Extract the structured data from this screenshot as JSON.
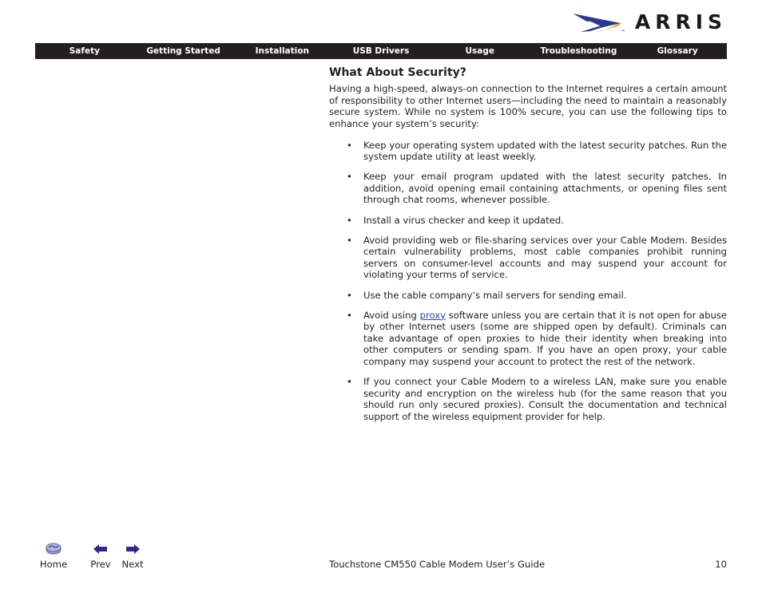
{
  "brand": {
    "name": "ARRIS",
    "logo_icon": "arris-swoosh-logo",
    "swoosh_blue": "#2b3990",
    "swoosh_orange": "#f7941e",
    "wordmark_color": "#1a1a1a"
  },
  "nav": {
    "background": "#231f20",
    "text_color": "#ffffff",
    "items": [
      {
        "label": "Safety"
      },
      {
        "label": "Getting Started"
      },
      {
        "label": "Installation"
      },
      {
        "label": "USB Drivers"
      },
      {
        "label": "Usage"
      },
      {
        "label": "Troubleshooting"
      },
      {
        "label": "Glossary"
      }
    ]
  },
  "main": {
    "title": "What About Security?",
    "intro": "Having a high-speed, always-on connection to the Internet requires a certain amount of responsibility to other Internet users—including the need to maintain a reasonably secure system. While no system is 100% secure, you can use the following tips to enhance your system’s security:",
    "bullet_glyph": "•",
    "tips": [
      {
        "text": "Keep your operating system updated with the latest security patches. Run the system update utility at least weekly."
      },
      {
        "text": "Keep your email program updated with the latest security patches. In addition, avoid opening email containing attachments, or opening files sent through chat rooms, whenever possible."
      },
      {
        "text": "Install a virus checker and keep it updated."
      },
      {
        "text": "Avoid providing web or file-sharing services over your Cable Modem. Besides certain vulnerability problems, most cable companies prohibit running servers on consumer-level accounts and may suspend your account for violating your terms of service."
      },
      {
        "text": "Use the cable company’s mail servers for sending email."
      },
      {
        "text_before": "Avoid using ",
        "link": "proxy",
        "link_color": "#3b3bb5",
        "text_after": " software unless you are certain that it is not open for abuse by other Internet users (some are shipped open by default). Criminals can take advantage of open proxies to hide their identity when breaking into other computers or sending spam. If you have an open proxy, your cable company may suspend your account to protect the rest of the network."
      },
      {
        "text": "If you connect your Cable Modem to a wireless LAN, make sure you enable security and encryption on the wireless hub (for the same reason that you should run only secured proxies). Consult the documentation and technical support of the wireless equipment provider for help."
      }
    ]
  },
  "footer": {
    "home_label": "Home",
    "prev_label": "Prev",
    "next_label": "Next",
    "home_icon": "home-disc-icon",
    "prev_icon": "arrow-left-icon",
    "next_icon": "arrow-right-icon",
    "arrow_color": "#2b2b8c",
    "home_icon_color": "#8b8bc8",
    "document_title": "Touchstone CM550 Cable Modem User’s Guide",
    "page_number": "10"
  }
}
